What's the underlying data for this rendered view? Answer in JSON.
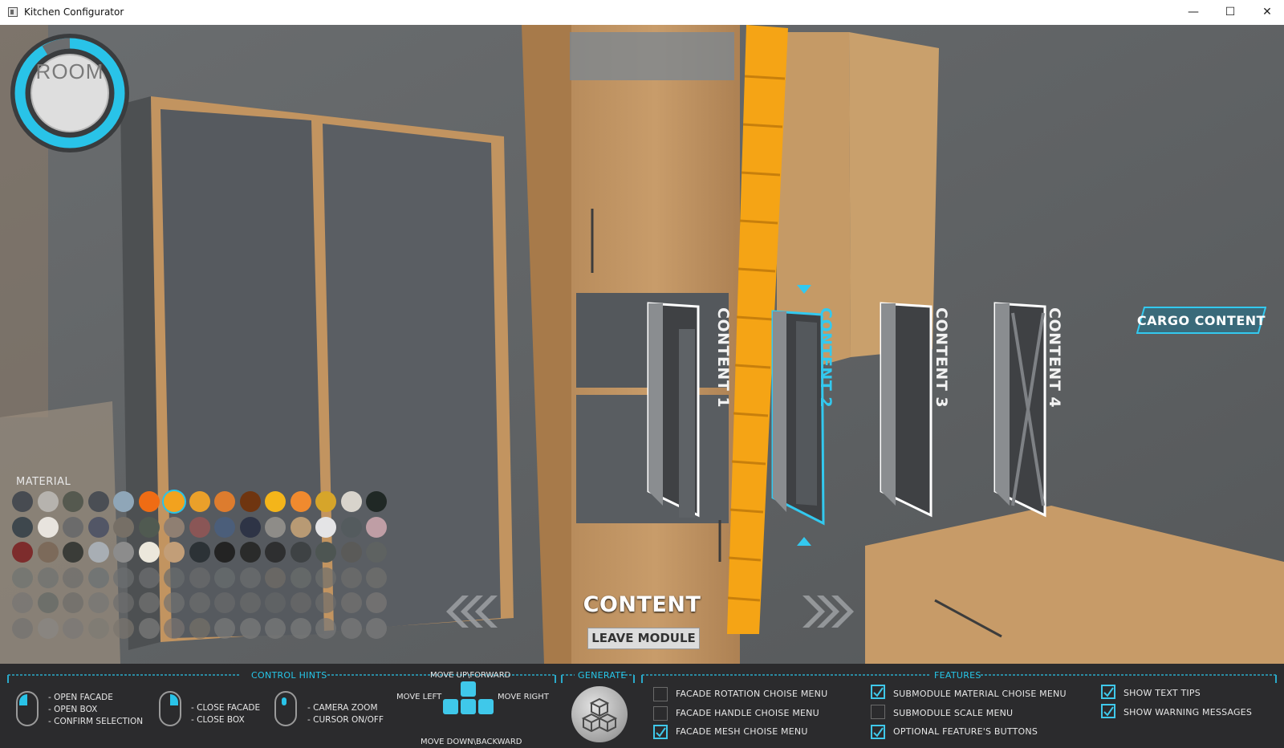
{
  "window": {
    "title": "Kitchen Configurator",
    "minimize": "—",
    "maximize": "☐",
    "close": "✕"
  },
  "room": {
    "label": "ROOM"
  },
  "material": {
    "title": "MATERIAL",
    "rows": [
      [
        "#474b51",
        "#b6b3ae",
        "#55594f",
        "#4a4e54",
        "#8fa6b8",
        "#ef6c14",
        "#f2a21e",
        "#eaa02a",
        "#dd7c2e",
        "#6f3510",
        "#f4b51a",
        "#f08a2e",
        "#d6a52a",
        "#d8d4cc",
        "#202825"
      ],
      [
        "#3e474d",
        "#e8e4de",
        "#6b6b6b",
        "#525666",
        "#766f66",
        "#505a51",
        "#8f7f72",
        "#8a5656",
        "#4b5e7a",
        "#2e3446",
        "#8e8c88",
        "#b89a74",
        "#e4e4e6",
        "#545b5e",
        "#bf9ea5"
      ],
      [
        "#7d2c2c",
        "#7c6a5a",
        "#3a3c38",
        "#a8aeb4",
        "#8c8c8c",
        "#ece8dc",
        "#c29e78",
        "#2c3236",
        "#232323",
        "#2a2b2a",
        "#2e2f30",
        "#3e4244",
        "#4d5552",
        "#5a5a58",
        "#5e6261"
      ],
      [
        "#6e7370",
        "#6e7270",
        "#6e6e6c",
        "#6a7074",
        "#6c6f70",
        "#6d6f72",
        "#6a6c6e",
        "#6b6b6c",
        "#6a6d6f",
        "#6c6e6f",
        "#726c66",
        "#6b6e6c",
        "#6d6f6d",
        "#6e6e6c",
        "#70706e"
      ],
      [
        "#767574",
        "#636865",
        "#6d6c6a",
        "#767675",
        "#6e6e6e",
        "#747474",
        "#727272",
        "#6e6e6e",
        "#696a6b",
        "#6b6b6b",
        "#646566",
        "#6b6a69",
        "#6c6c6c",
        "#747270",
        "#7a7876"
      ],
      [
        "#747270",
        "#8a8784",
        "#7a7876",
        "#7e7a74",
        "#7a756e",
        "#7c7c7c",
        "#7a7470",
        "#767068",
        "#7a7a7a",
        "#7c7c7c",
        "#7a7a7a",
        "#7c7c7c",
        "#787878",
        "#7a7a7a",
        "#7c7c7c"
      ]
    ]
  },
  "modules": [
    {
      "label": "CONTENT 1",
      "selected": false
    },
    {
      "label": "CONTENT 2",
      "selected": true
    },
    {
      "label": "CONTENT 3",
      "selected": false
    },
    {
      "label": "CONTENT 4",
      "selected": false
    }
  ],
  "content_title": "CONTENT",
  "leave_module": "LEAVE MODULE",
  "cargo_content": "CARGO CONTENT",
  "hints": {
    "title": "CONTROL HINTS",
    "left_mouse": [
      "- OPEN FACADE",
      "- OPEN BOX",
      "- CONFIRM SELECTION"
    ],
    "right_mouse": [
      "- CLOSE FACADE",
      "- CLOSE BOX"
    ],
    "middle_mouse": [
      "- CAMERA ZOOM",
      "- CURSOR ON/OFF"
    ],
    "move_up": "MOVE UP\\FORWARD",
    "move_left": "MOVE LEFT",
    "move_right": "MOVE RIGHT",
    "move_down": "MOVE DOWN\\BACKWARD"
  },
  "generate": {
    "title": "GENERATE"
  },
  "features": {
    "title": "FEATURES",
    "col1": [
      {
        "label": "FACADE ROTATION CHOISE MENU",
        "checked": false
      },
      {
        "label": "FACADE HANDLE CHOISE MENU",
        "checked": false
      },
      {
        "label": "FACADE MESH CHOISE MENU",
        "checked": true
      }
    ],
    "col2": [
      {
        "label": "SUBMODULE MATERIAL CHOISE MENU",
        "checked": true
      },
      {
        "label": "SUBMODULE SCALE MENU",
        "checked": false
      },
      {
        "label": "OPTIONAL FEATURE'S BUTTONS",
        "checked": true
      }
    ],
    "col3": [
      {
        "label": "SHOW TEXT TIPS",
        "checked": true
      },
      {
        "label": "SHOW WARNING MESSAGES",
        "checked": true
      }
    ]
  },
  "colors": {
    "accent": "#29c3e8",
    "highlight": "#f5a415"
  }
}
